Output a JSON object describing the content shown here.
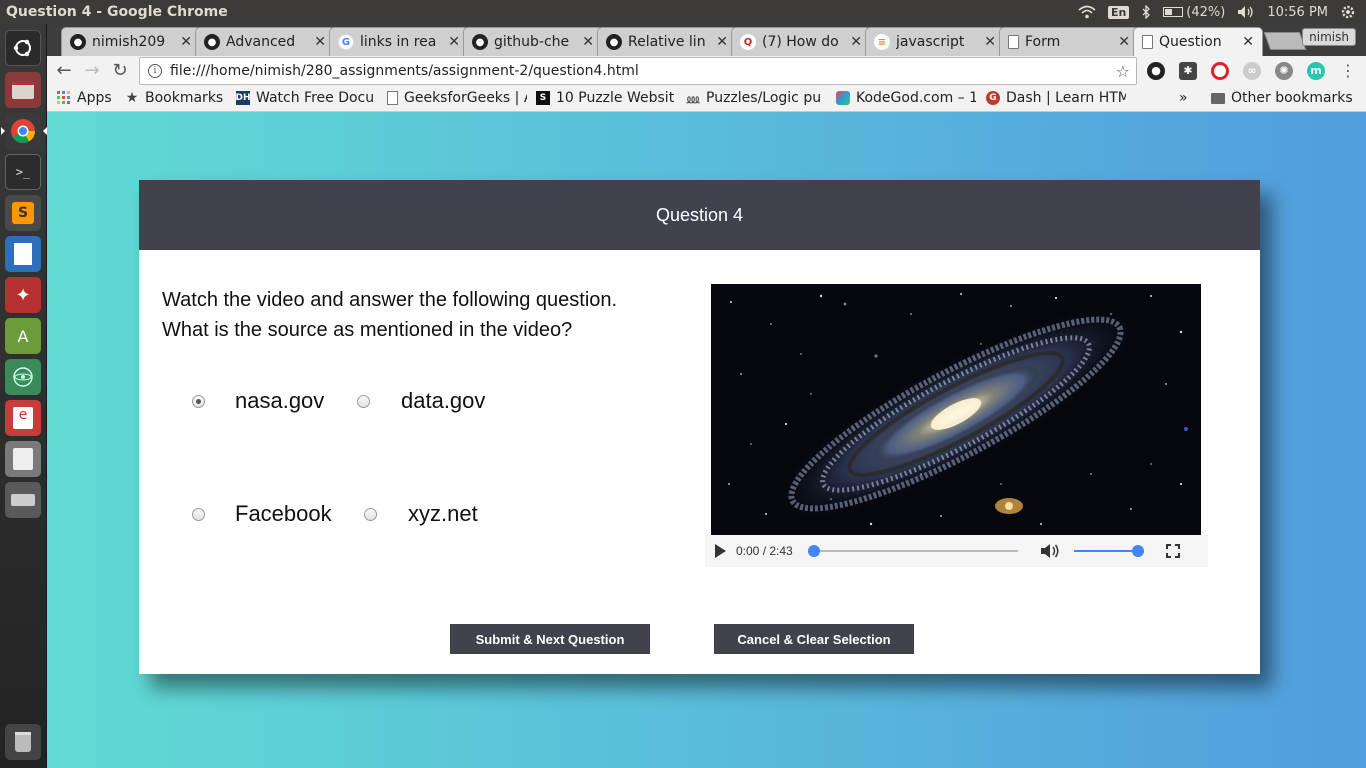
{
  "os": {
    "window_title": "Question 4 - Google Chrome",
    "keyboard_layout": "En",
    "battery": "(42%)",
    "clock": "10:56 PM",
    "launcher_icons": [
      "ubuntu-dash-icon",
      "files-icon",
      "chrome-icon",
      "terminal-icon",
      "sublime-text-icon",
      "libreoffice-writer-icon",
      "settings-icon",
      "android-studio-icon",
      "atom-icon",
      "pdf-reader-icon",
      "text-editor-icon",
      "disks-icon",
      "trash-icon"
    ]
  },
  "browser": {
    "tabs": [
      {
        "label": "nimish209",
        "icon": "github-icon"
      },
      {
        "label": "Advanced",
        "icon": "github-icon"
      },
      {
        "label": "links in rea",
        "icon": "google-icon"
      },
      {
        "label": "github-che",
        "icon": "github-icon"
      },
      {
        "label": "Relative lin",
        "icon": "github-icon"
      },
      {
        "label": "(7) How do",
        "icon": "quora-icon"
      },
      {
        "label": "javascript",
        "icon": "stackoverflow-icon"
      },
      {
        "label": "Form",
        "icon": "page-icon"
      },
      {
        "label": "Question",
        "icon": "page-icon"
      }
    ],
    "profile_name": "nimish",
    "url": "file:///home/nimish/280_assignments/assignment-2/question4.html",
    "bookmarks": [
      {
        "label": "Apps",
        "icon": "apps-grid-icon"
      },
      {
        "label": "Bookmarks",
        "icon": "star-icon"
      },
      {
        "label": "Watch Free Docu",
        "icon": "dh-icon"
      },
      {
        "label": "GeeksforGeeks | A",
        "icon": "page-icon"
      },
      {
        "label": "10 Puzzle Websit",
        "icon": "s-icon"
      },
      {
        "label": "Puzzles/Logic pu",
        "icon": "puzzle-icon"
      },
      {
        "label": "KodeGod.com – 1",
        "icon": "kodegod-icon"
      },
      {
        "label": "Dash | Learn HTM",
        "icon": "dash-icon"
      }
    ],
    "more_bookmarks": "»",
    "other_bookmarks": "Other bookmarks"
  },
  "page": {
    "header_title": "Question 4",
    "question_line1": "Watch the video and answer the following question.",
    "question_line2": "What is the source as mentioned in the video?",
    "options": [
      {
        "label": "nasa.gov",
        "selected": true
      },
      {
        "label": "data.gov",
        "selected": false
      },
      {
        "label": "Facebook",
        "selected": false
      },
      {
        "label": "xyz.net",
        "selected": false
      }
    ],
    "video": {
      "time": "0:00 / 2:43",
      "progress": 0.0,
      "volume": 1.0
    },
    "submit_label": "Submit & Next Question",
    "cancel_label": "Cancel & Clear Selection"
  },
  "colors": {
    "header_bg": "#41424d",
    "bg_gradient_start": "#5fdbd3",
    "bg_gradient_end": "#519ddd",
    "media_accent": "#4285f4"
  }
}
